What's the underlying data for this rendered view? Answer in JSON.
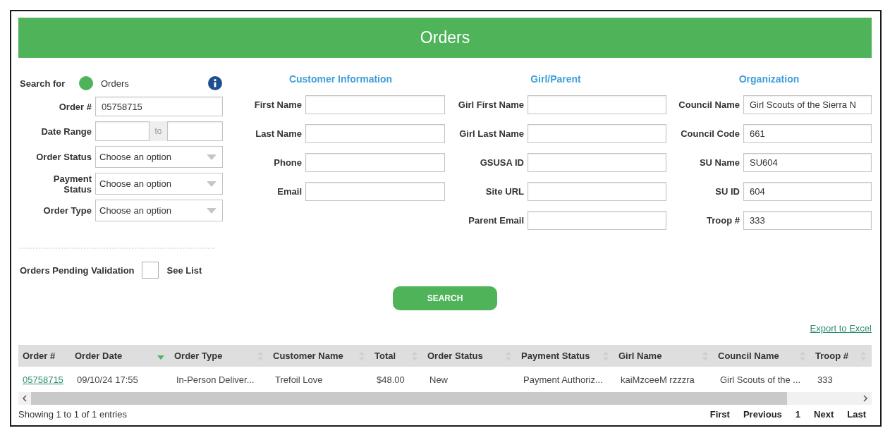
{
  "page": {
    "title": "Orders"
  },
  "search_panel": {
    "search_for": {
      "label": "Search for",
      "option": "Orders",
      "selected": true
    },
    "fields": [
      {
        "kind": "text",
        "label": "Order #",
        "value": "05758715"
      },
      {
        "kind": "date_range",
        "label": "Date Range",
        "separator": "to"
      },
      {
        "kind": "select",
        "label": "Order Status",
        "placeholder": "Choose an option"
      },
      {
        "kind": "select",
        "label": "Payment Status",
        "placeholder": "Choose an option"
      },
      {
        "kind": "select",
        "label": "Order Type",
        "placeholder": "Choose an option"
      }
    ],
    "pending": {
      "label": "Orders Pending Validation",
      "checked": false,
      "link": "See List"
    }
  },
  "sections": [
    {
      "title": "Customer Information",
      "fields": [
        {
          "label": "First Name"
        },
        {
          "label": "Last Name"
        },
        {
          "label": "Phone"
        },
        {
          "label": "Email"
        }
      ]
    },
    {
      "title": "Girl/Parent",
      "fields": [
        {
          "label": "Girl First Name"
        },
        {
          "label": "Girl Last Name"
        },
        {
          "label": "GSUSA ID"
        },
        {
          "label": "Site URL"
        },
        {
          "label": "Parent Email"
        }
      ]
    },
    {
      "title": "Organization",
      "fields": [
        {
          "label": "Council Name",
          "value": "Girl Scouts of the Sierra N"
        },
        {
          "label": "Council Code",
          "value": "661"
        },
        {
          "label": "SU Name",
          "value": "SU604"
        },
        {
          "label": "SU ID",
          "value": "604"
        },
        {
          "label": "Troop #",
          "value": "333"
        }
      ]
    }
  ],
  "search_button": "SEARCH",
  "export_link": "Export to Excel",
  "table": {
    "columns": [
      {
        "label": "Order #",
        "kind": "link",
        "sortable": false,
        "sorted": false
      },
      {
        "label": "Order Date",
        "kind": "text",
        "sortable": true,
        "sorted": true
      },
      {
        "label": "Order Type",
        "kind": "text",
        "sortable": true,
        "sorted": false
      },
      {
        "label": "Customer Name",
        "kind": "text",
        "sortable": true,
        "sorted": false
      },
      {
        "label": "Total",
        "kind": "text",
        "sortable": true,
        "sorted": false
      },
      {
        "label": "Order Status",
        "kind": "text",
        "sortable": true,
        "sorted": false
      },
      {
        "label": "Payment Status",
        "kind": "text",
        "sortable": true,
        "sorted": false
      },
      {
        "label": "Girl Name",
        "kind": "text",
        "sortable": true,
        "sorted": false
      },
      {
        "label": "Council Name",
        "kind": "text",
        "sortable": true,
        "sorted": false
      },
      {
        "label": "Troop #",
        "kind": "text",
        "sortable": true,
        "sorted": false
      }
    ],
    "rows": [
      [
        "05758715",
        "09/10/24 17:55",
        "In-Person Deliver...",
        "Trefoil Love",
        "$48.00",
        "New",
        "Payment Authoriz...",
        "kaiMzceeM rzzzra",
        "Girl Scouts of the ...",
        "333"
      ]
    ]
  },
  "footer": {
    "info": "Showing 1 to 1 of 1 entries",
    "pagination": [
      "First",
      "Previous",
      "1",
      "Next",
      "Last"
    ]
  }
}
